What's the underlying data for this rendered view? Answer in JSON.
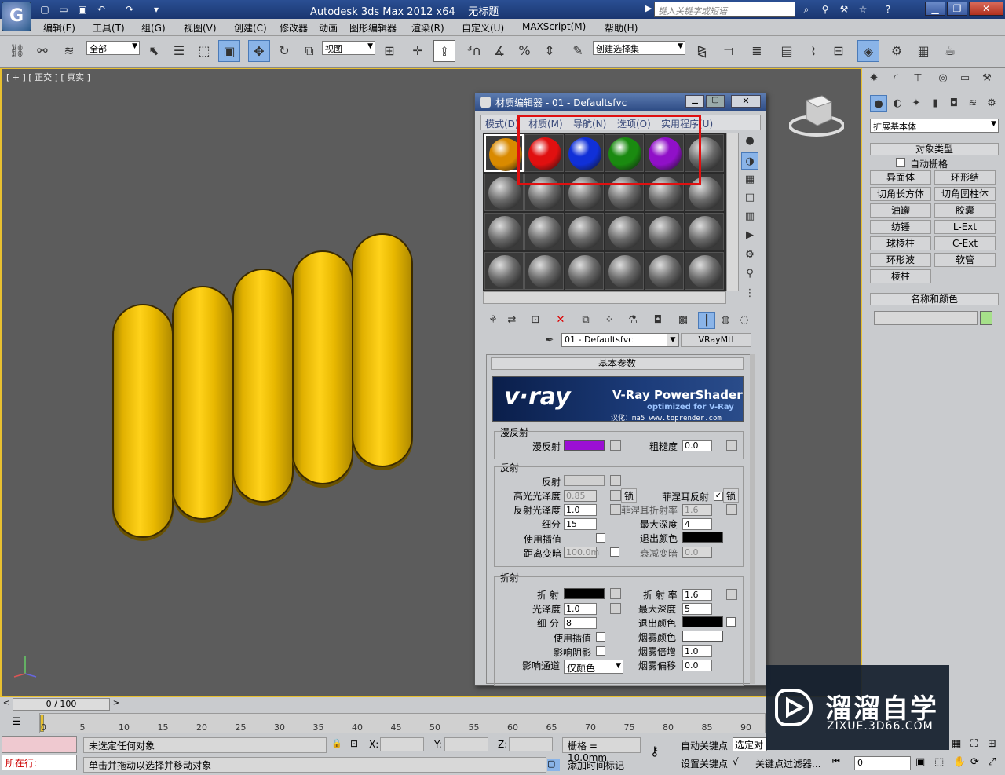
{
  "title": {
    "app": "Autodesk 3ds Max  2012 x64",
    "doc": "无标题",
    "search_placeholder": "键入关键字或短语"
  },
  "menu": [
    "编辑(E)",
    "工具(T)",
    "组(G)",
    "视图(V)",
    "创建(C)",
    "修改器",
    "动画",
    "图形编辑器",
    "渲染(R)",
    "自定义(U)",
    "MAXScript(M)",
    "帮助(H)"
  ],
  "toolbar": {
    "selection_filter": "全部",
    "ref_coord": "视图",
    "named_selection": "创建选择集"
  },
  "viewport": {
    "label": "[ + ] [ 正交 ] [ 真实 ]"
  },
  "command_panel": {
    "dropdown": "扩展基本体",
    "object_type_header": "对象类型",
    "auto_grid": "自动栅格",
    "buttons": [
      "异面体",
      "环形结",
      "切角长方体",
      "切角圆柱体",
      "油罐",
      "胶囊",
      "纺锤",
      "L-Ext",
      "球棱柱",
      "C-Ext",
      "环形波",
      "软管",
      "棱柱"
    ],
    "name_color_header": "名称和颜色"
  },
  "material_editor": {
    "title": "材质编辑器 - 01 - Defaultsfvc",
    "menus": [
      "模式(D)",
      "材质(M)",
      "导航(N)",
      "选项(O)",
      "实用程序(U)"
    ],
    "material_name": "01 - Defaultsfvc",
    "material_type": "VRayMtl",
    "rollout_title": "基本参数",
    "banner": {
      "brand": "v·ray",
      "product": "V-Ray PowerShader",
      "tagline": "optimized for V-Ray",
      "credit": "汉化：ma5 www.toprender.com"
    },
    "diffuse_group": "漫反射",
    "diffuse_label": "漫反射",
    "roughness_label": "粗糙度",
    "roughness": "0.0",
    "reflect_group": "反射",
    "reflect_label": "反射",
    "hilight_gloss_label": "高光光泽度",
    "hilight_gloss": "0.85",
    "lock_label": "锁",
    "fresnel_label": "菲涅耳反射",
    "refl_gloss_label": "反射光泽度",
    "refl_gloss": "1.0",
    "fresnel_ior_label": "菲涅耳折射率",
    "fresnel_ior": "1.6",
    "subdivs_label": "细分",
    "subdivs": "15",
    "max_depth_label": "最大深度",
    "max_depth": "4",
    "use_interp_label": "使用插值",
    "exit_color_label": "退出颜色",
    "dim_dist_label": "距离变暗",
    "dim_dist": "100.0m",
    "dim_falloff_label": "衰减变暗",
    "dim_falloff": "0.0",
    "refract_group": "折射",
    "refract_label": "折 射",
    "ior_label": "折 射 率",
    "ior": "1.6",
    "gloss_label": "光泽度",
    "gloss": "1.0",
    "refr_max_depth_label": "最大深度",
    "refr_max_depth": "5",
    "refr_subdivs_label": "细 分",
    "refr_subdivs": "8",
    "refr_exit_color_label": "退出颜色",
    "refr_use_interp_label": "使用插值",
    "fog_color_label": "烟雾颜色",
    "affect_shadows_label": "影响阴影",
    "fog_mult_label": "烟雾倍增",
    "fog_mult": "1.0",
    "affect_channels_label": "影响通道",
    "affect_channels": "仅颜色",
    "fog_bias_label": "烟雾偏移",
    "fog_bias": "0.0",
    "colors": {
      "diffuse": "#9b0fd4",
      "reflect": "#d0d0d0",
      "exit": "#000000",
      "refract": "#000000",
      "refr_exit": "#000000",
      "fog": "#ffffff"
    },
    "slot_colors": [
      "#d98a00",
      "#e01010",
      "#1030d8",
      "#1a8a10",
      "#9010c8"
    ]
  },
  "timeline": {
    "frame": "0 / 100",
    "ticks": [
      "0",
      "5",
      "10",
      "15",
      "20",
      "25",
      "30",
      "35",
      "40",
      "45",
      "50",
      "55",
      "60",
      "65",
      "70",
      "75",
      "80",
      "85",
      "90"
    ]
  },
  "status": {
    "no_selection": "未选定任何对象",
    "prompt": "单击并拖动以选择并移动对象",
    "x_label": "X:",
    "y_label": "Y:",
    "z_label": "Z:",
    "grid": "栅格 = 10.0mm",
    "add_time_tag": "添加时间标记",
    "auto_key": "自动关键点",
    "set_key": "设置关键点",
    "selected": "选定对象",
    "key_filters": "关键点过滤器...",
    "frame_field": "0",
    "script_label": "所在行:"
  },
  "watermark": {
    "brand": "溜溜自学",
    "url": "ZIXUE.3D66.COM"
  }
}
